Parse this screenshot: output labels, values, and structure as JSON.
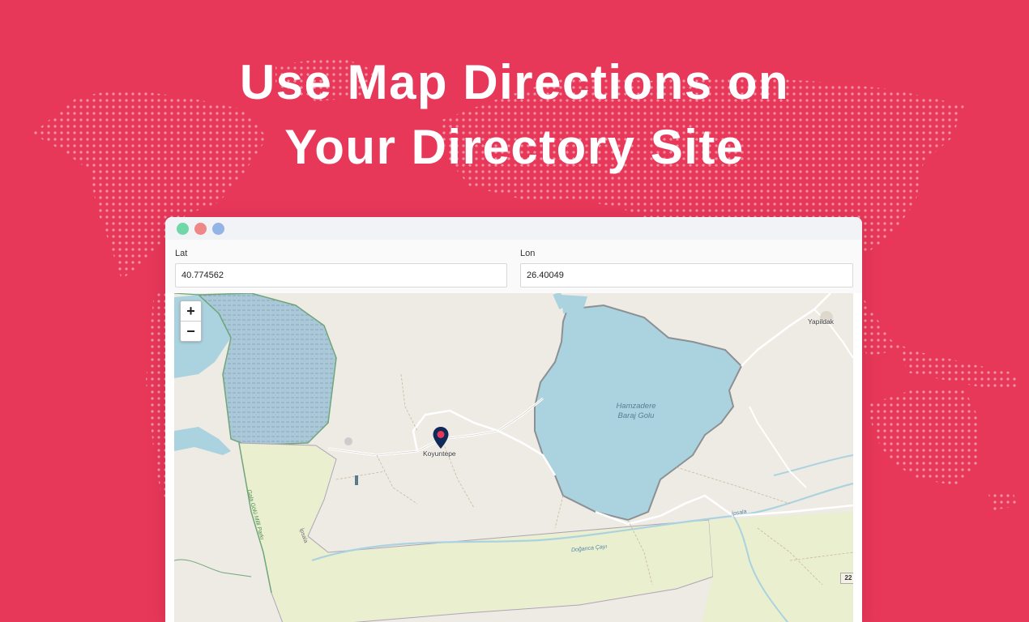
{
  "banner": {
    "headline_line1": "Use Map Directions on",
    "headline_line2": "Your Directory Site",
    "background_color": "#e8385a"
  },
  "window": {
    "controls": [
      "green-dot",
      "red-dot",
      "blue-dot"
    ]
  },
  "form": {
    "lat_label": "Lat",
    "lat_value": "40.774562",
    "lon_label": "Lon",
    "lon_value": "26.40049"
  },
  "map": {
    "zoom_in": "+",
    "zoom_out": "−",
    "marker_label": "Koyuntepe",
    "lake_label_line1": "Hamzadere",
    "lake_label_line2": "Baraj Golu",
    "village_label": "Yapildak",
    "river_label": "Doğanca Çayı",
    "road_label": "İpsala",
    "road_label_2": "İpsala",
    "park_label": "Gala Gölü Milli Parkı",
    "route_shield": "22"
  }
}
